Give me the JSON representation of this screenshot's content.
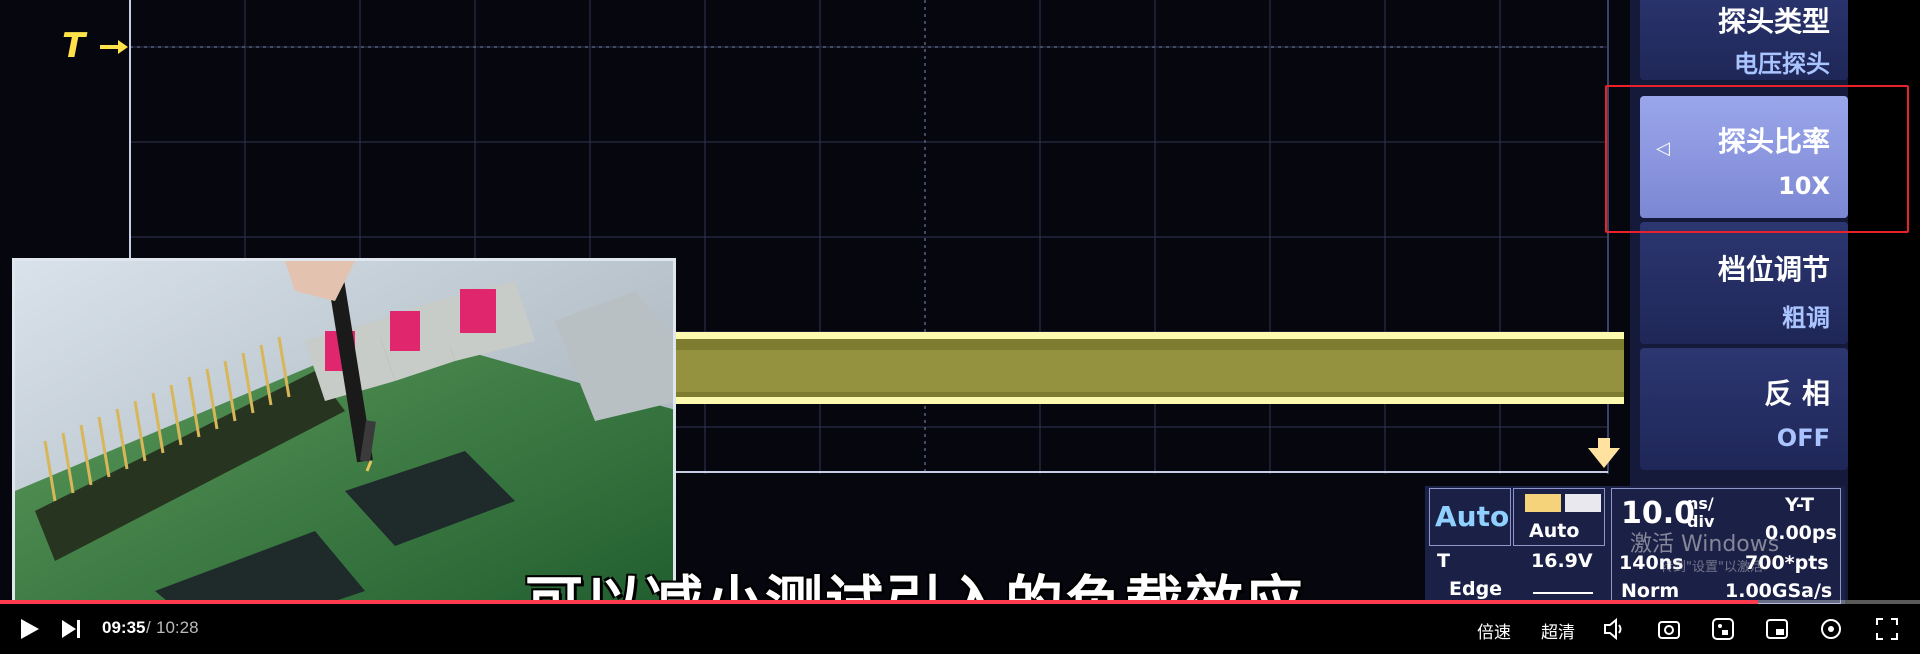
{
  "scope": {
    "trigger_marker": "T",
    "menu": [
      {
        "title": "探头类型",
        "value": "电压探头",
        "selected": false
      },
      {
        "title": "探头比率",
        "value": "10X",
        "selected": true
      },
      {
        "title": "档位调节",
        "value": "粗调",
        "selected": false
      },
      {
        "title": "反 相",
        "value": "OFF",
        "selected": false
      }
    ],
    "status": {
      "trigger_mode": "Auto",
      "sweep_mode": "Auto",
      "trigger_label": "T",
      "trigger_level": "16.9V",
      "trigger_type": "Edge",
      "time_base_value": "10.0",
      "time_base_unit_top": "ns/",
      "time_base_unit_bottom": "div",
      "time_mode": "Y-T",
      "delay": "0.00ps",
      "memory_depth": "140ns",
      "points": "700*pts",
      "acq_mode": "Norm",
      "sample_rate": "1.00GSa/s"
    }
  },
  "subtitle": "可以减小测试引入的负载效应",
  "watermark": {
    "title": "激活 Windows",
    "hint": "转到\"设置\"以激活"
  },
  "player": {
    "current_time": "09:35",
    "total_time": "10:28",
    "progress": 0.9156,
    "speed_label": "倍速",
    "quality_label": "超清",
    "accent_color": "#ff3b4e"
  }
}
